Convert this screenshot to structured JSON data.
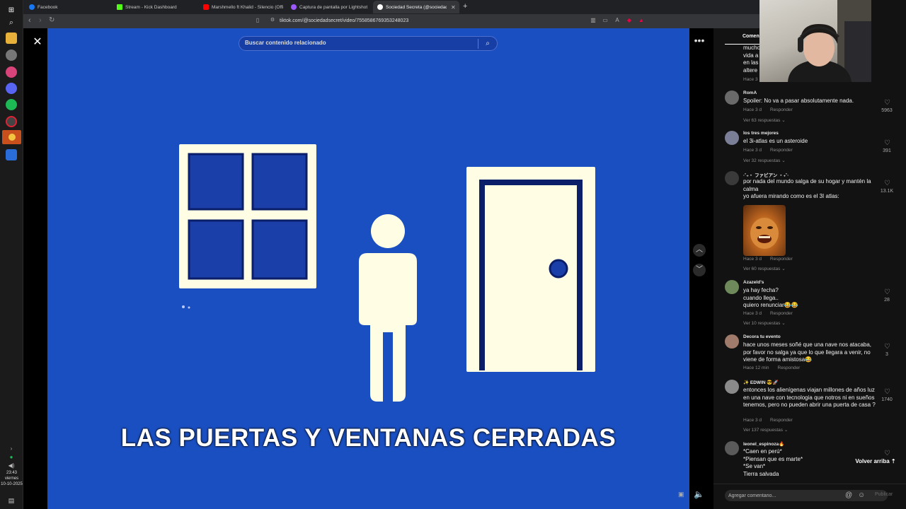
{
  "browser": {
    "tabs": [
      {
        "title": "Facebook",
        "favicon_color": "#1877f2"
      },
      {
        "title": "Stream - Kick Dashboard",
        "favicon_color": "#53fc18"
      },
      {
        "title": "Marshmello ft Khalid - Silencio (Offi",
        "favicon_color": "#ff0000"
      },
      {
        "title": "Captura de pantalla por Lightshot",
        "favicon_color": "#9b59ff"
      },
      {
        "title": "Sociedad Secreta (@sociedadse",
        "favicon_color": "#ffffff"
      }
    ],
    "active_tab": 4,
    "new_tab": "+",
    "url": "tiktok.com/@sociedadsecret/video/7558586769353248023"
  },
  "taskbar": {
    "clock_time": "23:43",
    "clock_day": "viernes",
    "clock_date": "10-10-2025"
  },
  "video": {
    "search_placeholder": "Buscar contenido relacionado",
    "caption": "LAS PUERTAS Y VENTANAS CERRADAS",
    "background_color": "#1a4fc2"
  },
  "comments_panel": {
    "tab_label": "Comen",
    "back_to_top": "Volver arriba",
    "input_placeholder": "Agregar comentario...",
    "publish_label": "Publicar",
    "partial_top": {
      "lines": [
        "mucho",
        "vida a",
        "en las",
        "altere"
      ],
      "time": "Hace 3"
    },
    "items": [
      {
        "user": "RomA",
        "text": "Spoiler: No va a pasar absolutamente nada.",
        "time": "Hace 3 d",
        "reply": "Responder",
        "replies": "Ver 63 respuestas",
        "likes": "5963"
      },
      {
        "user": "los tres mejores",
        "text": "el 3i-atlas es un asteroide",
        "time": "Hace 3 d",
        "reply": "Responder",
        "replies": "Ver 32 respuestas",
        "likes": "391"
      },
      {
        "user": "·˚₊‧ ファビアン ‧₊˚·",
        "text": "por nada del mundo salga de su hogar y mantén la calma\nyo afuera mirando como es el 3I atlas:",
        "time": "Hace 3 d",
        "reply": "Responder",
        "replies": "Ver 60 respuestas",
        "likes": "13.1K"
      },
      {
        "user": "Azazeld's",
        "text": "ya hay fecha?\ncuando llega..\nquiero renunciar😂😂",
        "time": "Hace 3 d",
        "reply": "Responder",
        "replies": "Ver 10 respuestas",
        "likes": "28"
      },
      {
        "user": "Decora tu evento",
        "text": "hace unos meses soñé que una nave nos atacaba, por favor no salga ya que lo que llegara a venir, no viene de forma amistosa😂",
        "time": "Hace 12 min",
        "reply": "Responder",
        "replies": "",
        "likes": "3"
      },
      {
        "user": "✨ EDWIN 😎🚀",
        "text": "entonces los alienígenas viajan millones de años luz en una nave con tecnologia que notros ni en sueños tenemos, pero no pueden abrir una puerta de casa ?",
        "time": "Hace 3 d",
        "reply": "Responder",
        "replies": "Ver 137 respuestas",
        "likes": "1740"
      },
      {
        "user": "leonel_espinoza🔥",
        "text": "*Caen en perú*\n*Piensan que es marte*\n*Se van*\nTierra salvada",
        "time": "",
        "reply": "",
        "replies": "",
        "likes": ""
      }
    ]
  }
}
